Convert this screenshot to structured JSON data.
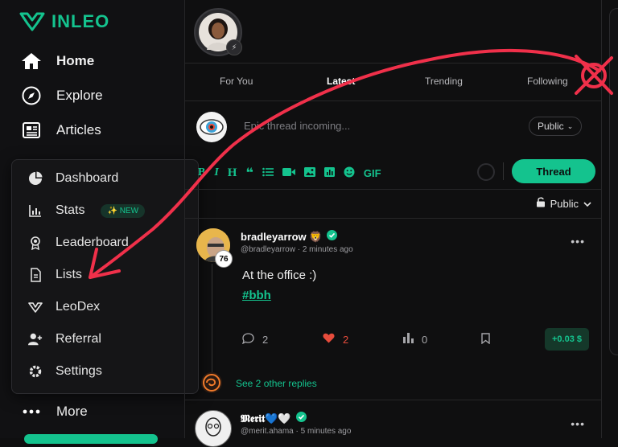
{
  "brand": {
    "name": "INLEO",
    "accent": "#14c38e"
  },
  "nav": {
    "items": [
      {
        "label": "Home",
        "icon": "home-icon"
      },
      {
        "label": "Explore",
        "icon": "compass-icon"
      },
      {
        "label": "Articles",
        "icon": "newspaper-icon"
      }
    ],
    "more_label": "More"
  },
  "popup": {
    "items": [
      {
        "label": "Dashboard",
        "icon": "pie-chart-icon"
      },
      {
        "label": "Stats",
        "icon": "bar-chart-icon",
        "badge": "✨ NEW"
      },
      {
        "label": "Leaderboard",
        "icon": "medal-icon"
      },
      {
        "label": "Lists",
        "icon": "document-icon"
      },
      {
        "label": "LeoDex",
        "icon": "leo-icon"
      },
      {
        "label": "Referral",
        "icon": "user-plus-icon"
      },
      {
        "label": "Settings",
        "icon": "gear-icon"
      }
    ]
  },
  "tabs": [
    "For You",
    "Latest",
    "Trending",
    "Following"
  ],
  "active_tab": "Latest",
  "composer": {
    "placeholder": "Epic thread incoming...",
    "visibility": "Public",
    "gif_label": "GIF",
    "submit_label": "Thread"
  },
  "feed_visibility": "Public",
  "posts": [
    {
      "username": "bradleyarrow 🦁",
      "handle": "@bradleyarrow · 2 minutes ago",
      "reputation": "76",
      "text": "At the office :)",
      "hashtag": "#bbh",
      "comments": "2",
      "likes": "2",
      "votes": "0",
      "earnings": "+0.03 $",
      "replies_label": "See 2 other replies"
    },
    {
      "username": "𝕸𝖊𝖗𝖎𝖙💙🤍",
      "handle": "@merit.ahama · 5 minutes ago"
    }
  ]
}
